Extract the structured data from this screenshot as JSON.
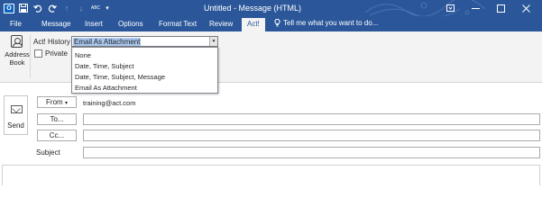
{
  "titlebar": {
    "title": "Untitled - Message (HTML)",
    "quick_access": [
      "save-icon",
      "undo-icon",
      "redo-icon",
      "up-icon",
      "down-icon",
      "abc-spellcheck-icon",
      "customize-icon"
    ],
    "abc": "ABC",
    "controls": [
      "ribbon-display-icon",
      "minimize-icon",
      "maximize-icon",
      "close-icon"
    ]
  },
  "tabs": {
    "items": [
      {
        "label": "File"
      },
      {
        "label": "Message"
      },
      {
        "label": "Insert"
      },
      {
        "label": "Options"
      },
      {
        "label": "Format Text"
      },
      {
        "label": "Review"
      },
      {
        "label": "Act!"
      }
    ],
    "active": "Act!",
    "tell_me": "Tell me what you want to do..."
  },
  "ribbon": {
    "address_book": "Address Book",
    "act_history_label": "Act! History",
    "act_history_value": "Email As Attachment",
    "private_label": "Private",
    "private_checked": false
  },
  "dropdown": {
    "options": [
      "None",
      "Date, Time, Subject",
      "Date, Time, Subject, Message",
      "Email As Attachment"
    ]
  },
  "compose": {
    "send_label": "Send",
    "from_button": "From",
    "from_value": "training@act.com",
    "to_button": "To...",
    "cc_button": "Cc...",
    "subject_label": "Subject"
  },
  "colors": {
    "accent": "#2b579a",
    "ribbon_bg": "#f3f3f3",
    "selection": "#a9c7ef"
  }
}
